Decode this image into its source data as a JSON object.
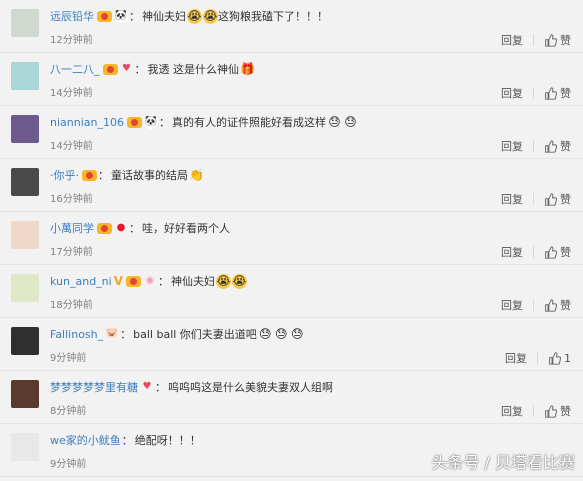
{
  "comments": [
    {
      "user": "远辰铅华",
      "badges": [
        "vip"
      ],
      "medal": "panda",
      "text": "神仙夫妇",
      "emojis": [
        "cry",
        "cry"
      ],
      "text2": "这狗粮我磕下了！！！",
      "time": "12分钟前",
      "reply": "回复",
      "like": "赞",
      "avatar_color": "#cfd9cf"
    },
    {
      "user": "八一二八_",
      "badges": [
        "vip"
      ],
      "medal": "heart",
      "text": "我透 这是什么神仙",
      "emojis": [
        "gift"
      ],
      "text2": "",
      "time": "14分钟前",
      "reply": "回复",
      "like": "赞",
      "avatar_color": "#a9d6d6"
    },
    {
      "user": "niannian_106",
      "badges": [
        "vip"
      ],
      "medal": "panda",
      "text": "真的有人的证件照能好看成这样",
      "emojis": [
        "sweat",
        "sweat"
      ],
      "text2": "",
      "time": "14分钟前",
      "reply": "回复",
      "like": "赞",
      "avatar_color": "#6e5a8c"
    },
    {
      "user": "·你乎·",
      "badges": [
        "vip"
      ],
      "medal": "",
      "text": "童话故事的结局",
      "emojis": [
        "clap"
      ],
      "text2": "",
      "time": "16分钟前",
      "reply": "回复",
      "like": "赞",
      "avatar_color": "#4a4a4a"
    },
    {
      "user": "小萬同学",
      "badges": [
        "vip"
      ],
      "medal": "weibo",
      "text": "哇，好好看两个人",
      "emojis": [],
      "text2": "",
      "time": "17分钟前",
      "reply": "回复",
      "like": "赞",
      "avatar_color": "#f0d8c8"
    },
    {
      "user": "kun_and_ni",
      "badges": [
        "v",
        "vip"
      ],
      "medal": "donut",
      "text": "神仙夫妇",
      "emojis": [
        "cry",
        "cry"
      ],
      "text2": "",
      "time": "18分钟前",
      "reply": "回复",
      "like": "赞",
      "avatar_color": "#dfe9c8"
    },
    {
      "user": "Fallinosh_",
      "badges": [],
      "medal": "pig",
      "text": "ball ball 你们夫妻出道吧",
      "emojis": [
        "sweat",
        "sweat",
        "sweat"
      ],
      "text2": "",
      "time": "9分钟前",
      "reply": "回复",
      "like": "1",
      "avatar_color": "#2f2f2f"
    },
    {
      "user": "梦梦梦梦梦里有糖",
      "badges": [],
      "medal": "heart",
      "text": "呜呜呜这是什么美貌夫妻双人组啊",
      "emojis": [],
      "text2": "",
      "time": "8分钟前",
      "reply": "回复",
      "like": "赞",
      "avatar_color": "#5b3a2e"
    },
    {
      "user": "we家的小鱿鱼",
      "badges": [],
      "medal": "",
      "text": "绝配呀！！！",
      "emojis": [],
      "text2": "",
      "time": "9分钟前",
      "reply": "",
      "like": "",
      "avatar_color": "#e8e8e8"
    }
  ],
  "watermark": "头条号 / 贝塔看比赛"
}
